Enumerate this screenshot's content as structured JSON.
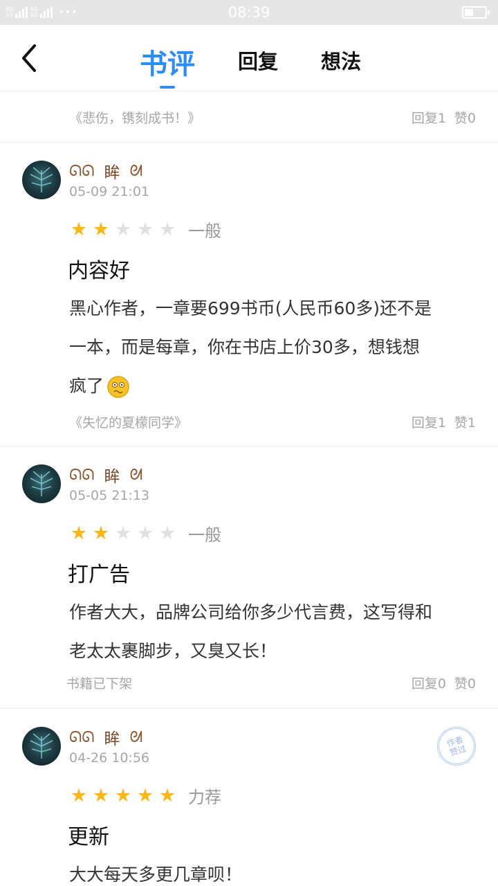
{
  "status_bar": {
    "network_1": "4G",
    "network_2": "4G",
    "network_3": "2G",
    "network_4": "2G",
    "time": "08:39",
    "more": "•••"
  },
  "nav": {
    "tabs": [
      {
        "label": "书评",
        "active": true
      },
      {
        "label": "回复",
        "active": false
      },
      {
        "label": "想法",
        "active": false
      }
    ]
  },
  "top_row": {
    "book": "《悲伤，镌刻成书！》",
    "reply": "回复1",
    "like": "赞0"
  },
  "reviews": [
    {
      "username": "眸",
      "date": "05-09 21:01",
      "rating": 2,
      "rating_label": "一般",
      "title": "内容好",
      "body_line1": "黑心作者，一章要699书币(人民币60多)还不是",
      "body_line2": "一本，而是每章，你在书店上价30多，想钱想",
      "body_line3": "疯了",
      "book": "《失忆的夏檬同学》",
      "reply": "回复1",
      "like": "赞1"
    },
    {
      "username": "眸",
      "date": "05-05 21:13",
      "rating": 2,
      "rating_label": "一般",
      "title": "打广告",
      "body_line1": "作者大大，品牌公司给你多少代言费，这写得和",
      "body_line2": "老太太裹脚步，又臭又长！",
      "book": "书籍已下架",
      "reply": "回复0",
      "like": "赞0"
    },
    {
      "username": "眸",
      "date": "04-26 10:56",
      "rating": 5,
      "rating_label": "力荐",
      "title": "更新",
      "body_line1": "大大每天多更几章呗！",
      "stamp": "作者\n赞过"
    }
  ],
  "colors": {
    "accent": "#2c8df4",
    "star_on": "#f9b71a",
    "star_off": "#e1e1e1",
    "meta_text": "#a6a6a6"
  }
}
